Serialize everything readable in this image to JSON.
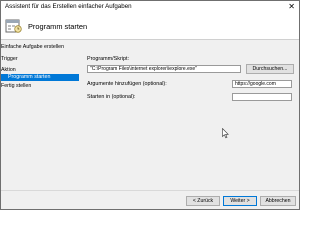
{
  "window": {
    "title": "Assistent für das Erstellen einfacher Aufgaben",
    "close_glyph": "✕"
  },
  "header": {
    "title": "Programm starten",
    "icon": "task-wizard-icon"
  },
  "sidebar": {
    "steps": [
      {
        "label": "Einfache Aufgabe erstellen"
      },
      {
        "label": "Trigger"
      },
      {
        "label": "Aktion"
      },
      {
        "label": "Programm starten"
      },
      {
        "label": "Fertig stellen"
      }
    ]
  },
  "form": {
    "program_label": "Programm/Skript:",
    "program_value": "\"C:\\Program Files\\internet explorer\\iexplore.exe\"",
    "browse_label": "Durchsuchen...",
    "args_label": "Argumente hinzufügen (optional):",
    "args_value": "https://google.com",
    "startin_label": "Starten in (optional):",
    "startin_value": ""
  },
  "footer": {
    "back_label": "< Zurück",
    "next_label": "Weiter >",
    "cancel_label": "Abbrechen"
  },
  "colors": {
    "accent": "#0078d7"
  }
}
